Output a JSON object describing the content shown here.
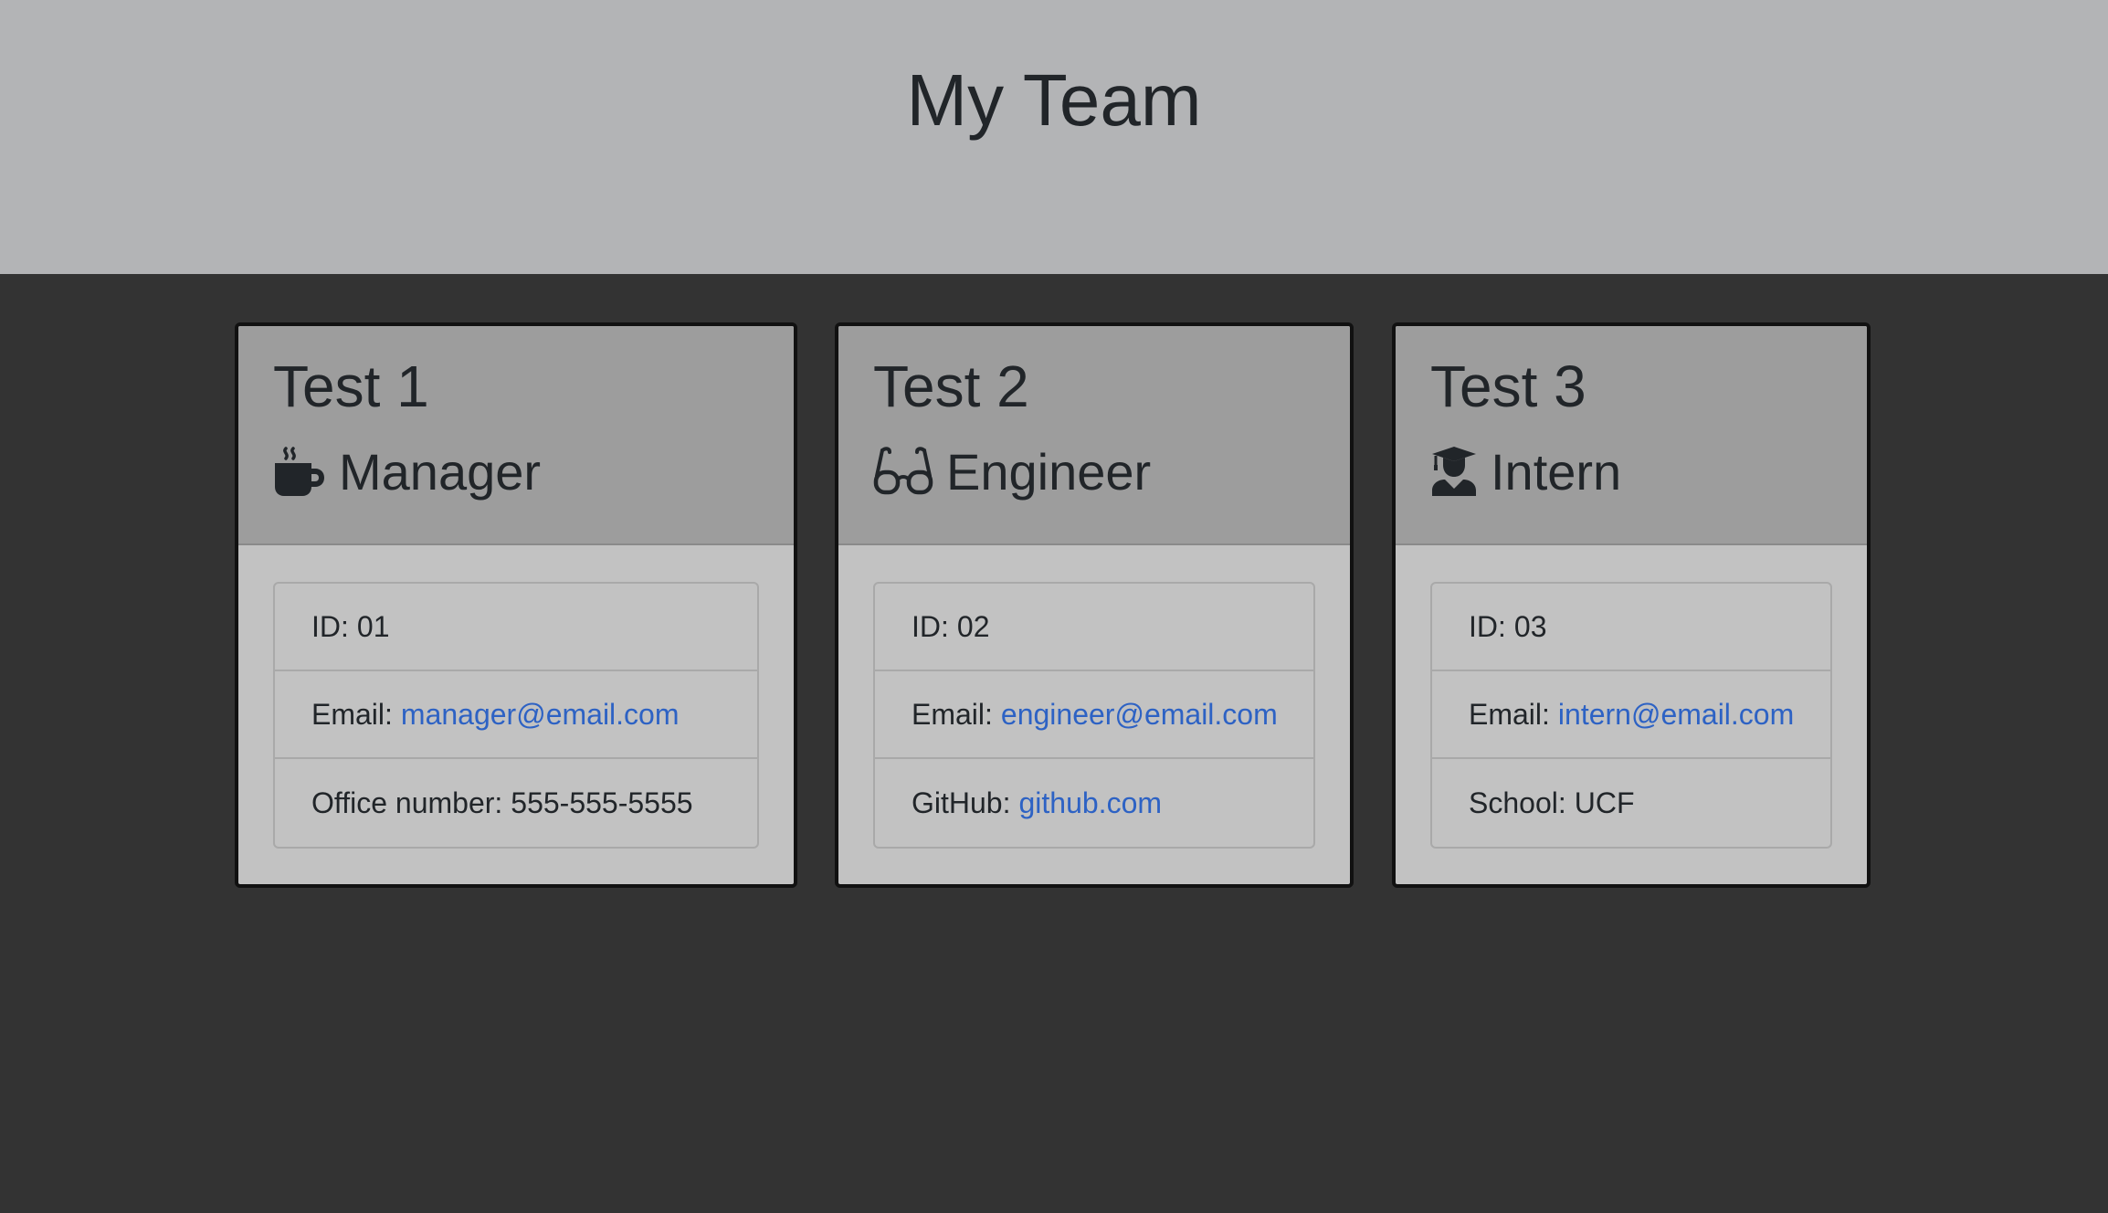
{
  "header": {
    "title": "My Team"
  },
  "cards": [
    {
      "name": "Test 1",
      "role": "Manager",
      "role_icon": "coffee-mug-icon",
      "id_label": "ID:",
      "id": "01",
      "email_label": "Email:",
      "email": "manager@email.com",
      "extra_label": "Office number:",
      "extra_value": "555-555-5555"
    },
    {
      "name": "Test 2",
      "role": "Engineer",
      "role_icon": "glasses-icon",
      "id_label": "ID:",
      "id": "02",
      "email_label": "Email:",
      "email": "engineer@email.com",
      "extra_label": "GitHub:",
      "extra_value": "github.com"
    },
    {
      "name": "Test 3",
      "role": "Intern",
      "role_icon": "graduate-icon",
      "id_label": "ID:",
      "id": "03",
      "email_label": "Email:",
      "email": "intern@email.com",
      "extra_label": "School:",
      "extra_value": "UCF"
    }
  ],
  "colors": {
    "page_bg": "#333333",
    "header_bg": "#b3b4b6",
    "card_head_bg": "#9d9d9d",
    "card_body_bg": "#c2c2c2",
    "link": "#2d62c4"
  }
}
